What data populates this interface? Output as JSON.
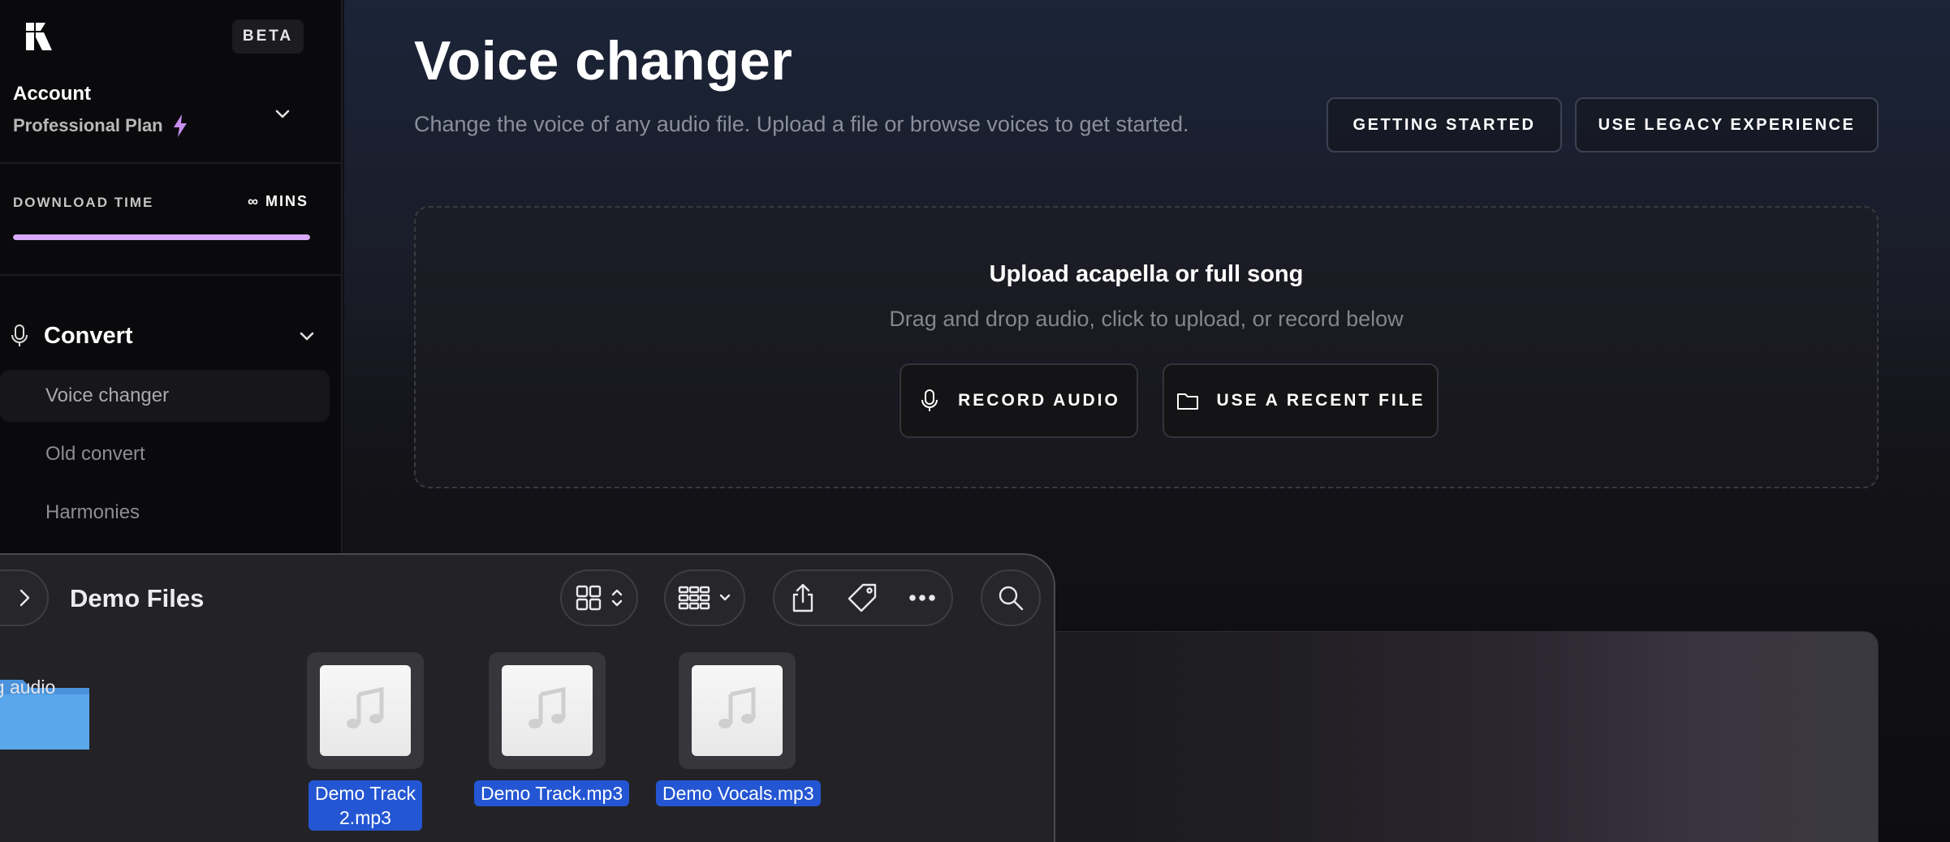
{
  "sidebar": {
    "beta_badge": "BETA",
    "account_label": "Account",
    "plan_label": "Professional Plan",
    "download_time_label": "DOWNLOAD TIME",
    "download_time_value": "∞ MINS",
    "download_progress": 1.0,
    "convert_section_label": "Convert",
    "nav_items": [
      {
        "label": "Voice changer",
        "active": true
      },
      {
        "label": "Old convert",
        "active": false
      },
      {
        "label": "Harmonies",
        "active": false
      }
    ]
  },
  "main": {
    "title": "Voice changer",
    "subtitle": "Change the voice of any audio file. Upload a file or browse voices to get started.",
    "getting_started_label": "GETTING STARTED",
    "legacy_label": "USE LEGACY EXPERIENCE",
    "upload": {
      "title": "Upload acapella or full song",
      "hint": "Drag and drop audio, click to upload, or record below",
      "record_label": "RECORD AUDIO",
      "recent_label": "USE A RECENT FILE"
    }
  },
  "finder": {
    "title": "Demo Files",
    "folder_name": "og audio",
    "files": [
      {
        "name_line1": "Demo Track",
        "name_line2": "2.mp3"
      },
      {
        "name_line1": "Demo Track.mp3",
        "name_line2": ""
      },
      {
        "name_line1": "Demo Vocals.mp3",
        "name_line2": ""
      }
    ]
  },
  "colors": {
    "accent_progress": "#d7a9f8",
    "selection_blue": "#2456d3",
    "folder_blue": "#5aa7ec"
  }
}
